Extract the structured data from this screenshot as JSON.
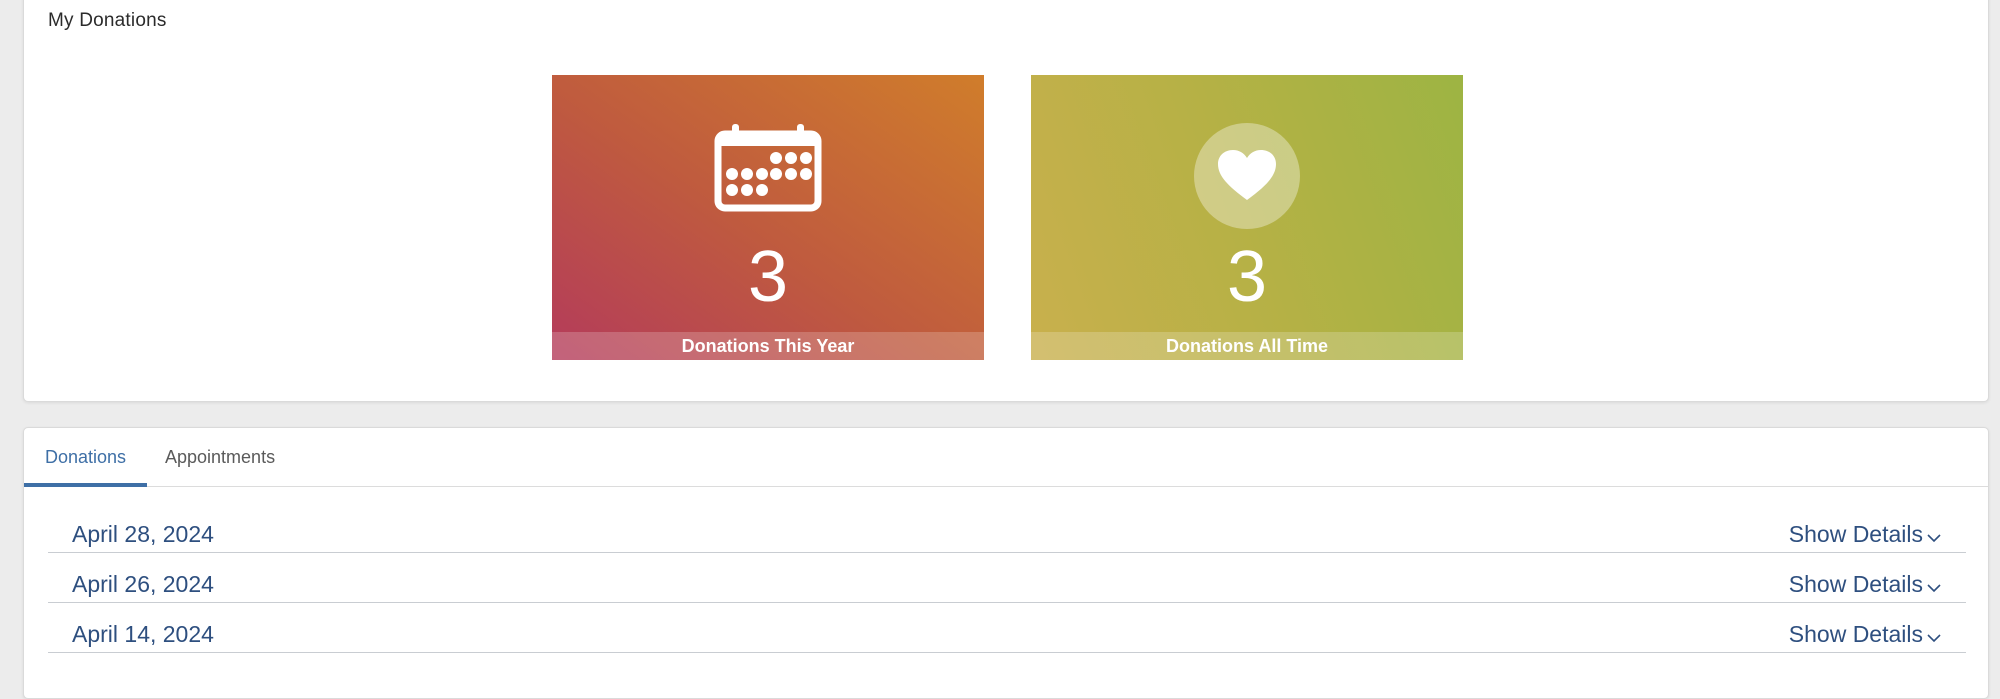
{
  "summary": {
    "title": "My Donations",
    "tiles": [
      {
        "value": "3",
        "caption": "Donations This Year",
        "icon": "calendar-icon"
      },
      {
        "value": "3",
        "caption": "Donations All Time",
        "icon": "heart-icon"
      }
    ]
  },
  "tabs": [
    {
      "label": "Donations",
      "active": true
    },
    {
      "label": "Appointments",
      "active": false
    }
  ],
  "donations": [
    {
      "date": "April 28, 2024",
      "action": "Show Details"
    },
    {
      "date": "April 26, 2024",
      "action": "Show Details"
    },
    {
      "date": "April 14, 2024",
      "action": "Show Details"
    }
  ],
  "colors": {
    "accent": "#3e6fa6",
    "link": "#2e4f7f",
    "tile_year_start": "#b43b5b",
    "tile_year_end": "#d07d2b",
    "tile_alltime_start": "#c9b04d",
    "tile_alltime_end": "#9db443"
  }
}
